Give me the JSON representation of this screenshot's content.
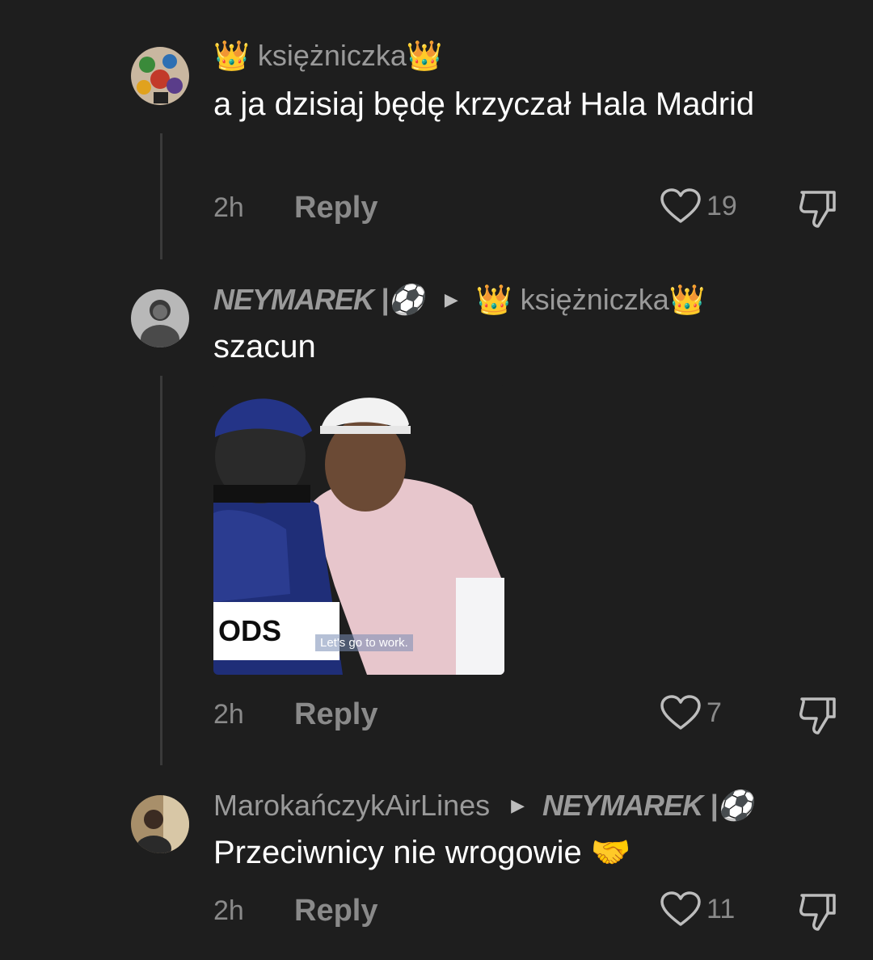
{
  "comments": [
    {
      "author": "👑 księżniczka👑",
      "text": "a ja dzisiaj będę krzyczał Hala Madrid",
      "time": "2h",
      "reply_label": "Reply",
      "likes": "19"
    },
    {
      "author": "NEYMAREK |⚽",
      "reply_to": "👑 księżniczka👑",
      "text": "szacun",
      "gif": {
        "caption": "Let's go to work.",
        "bib_text": "ODS"
      },
      "time": "2h",
      "reply_label": "Reply",
      "likes": "7"
    },
    {
      "author": "MarokańczykAirLines",
      "reply_to": "NEYMAREK |⚽",
      "text": "Przeciwnicy nie wrogowie 🤝",
      "time": "2h",
      "reply_label": "Reply",
      "likes": "11"
    }
  ],
  "colors": {
    "background": "#1e1e1e",
    "muted_text": "#9a9a9a",
    "thread_line": "#3a3a3a"
  },
  "icons": [
    "heart-icon",
    "thumbs-down-icon",
    "caret-right-icon"
  ]
}
